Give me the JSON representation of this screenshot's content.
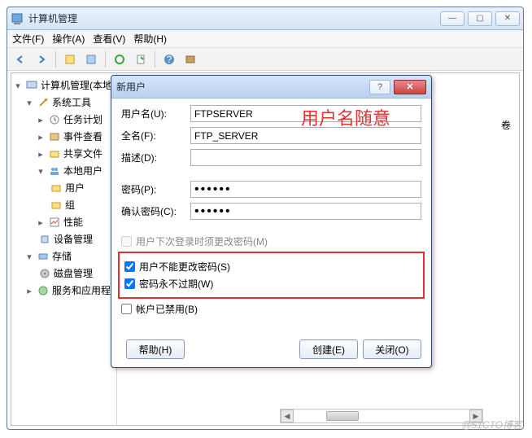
{
  "window": {
    "title": "计算机管理",
    "controls": {
      "min": "—",
      "max": "▢",
      "close": "✕"
    }
  },
  "menubar": {
    "file": "文件(F)",
    "action": "操作(A)",
    "view": "查看(V)",
    "help": "帮助(H)"
  },
  "tree": {
    "root": "计算机管理(本地",
    "system_tools": "系统工具",
    "task_scheduler": "任务计划",
    "event_viewer": "事件查看",
    "shared_folders": "共享文件",
    "local_users": "本地用户",
    "users": "用户",
    "groups": "组",
    "performance": "性能",
    "device_manager": "设备管理",
    "storage": "存储",
    "disk_mgmt": "磁盘管理",
    "services_apps": "服务和应用程"
  },
  "right_panel_col": "卷",
  "dialog": {
    "title": "新用户",
    "labels": {
      "username": "用户名(U):",
      "fullname": "全名(F):",
      "description": "描述(D):",
      "password": "密码(P):",
      "confirm": "确认密码(C):"
    },
    "values": {
      "username": "FTPSERVER",
      "fullname": "FTP_SERVER",
      "description": "",
      "password": "••••••",
      "confirm": "••••••"
    },
    "checks": {
      "must_change": "用户下次登录时须更改密码(M)",
      "cannot_change": "用户不能更改密码(S)",
      "never_expires": "密码永不过期(W)",
      "disabled": "帐户已禁用(B)"
    },
    "buttons": {
      "help": "帮助(H)",
      "create": "创建(E)",
      "close": "关闭(O)"
    }
  },
  "annotation": "用户名随意",
  "watermark": "@51CTO博客"
}
